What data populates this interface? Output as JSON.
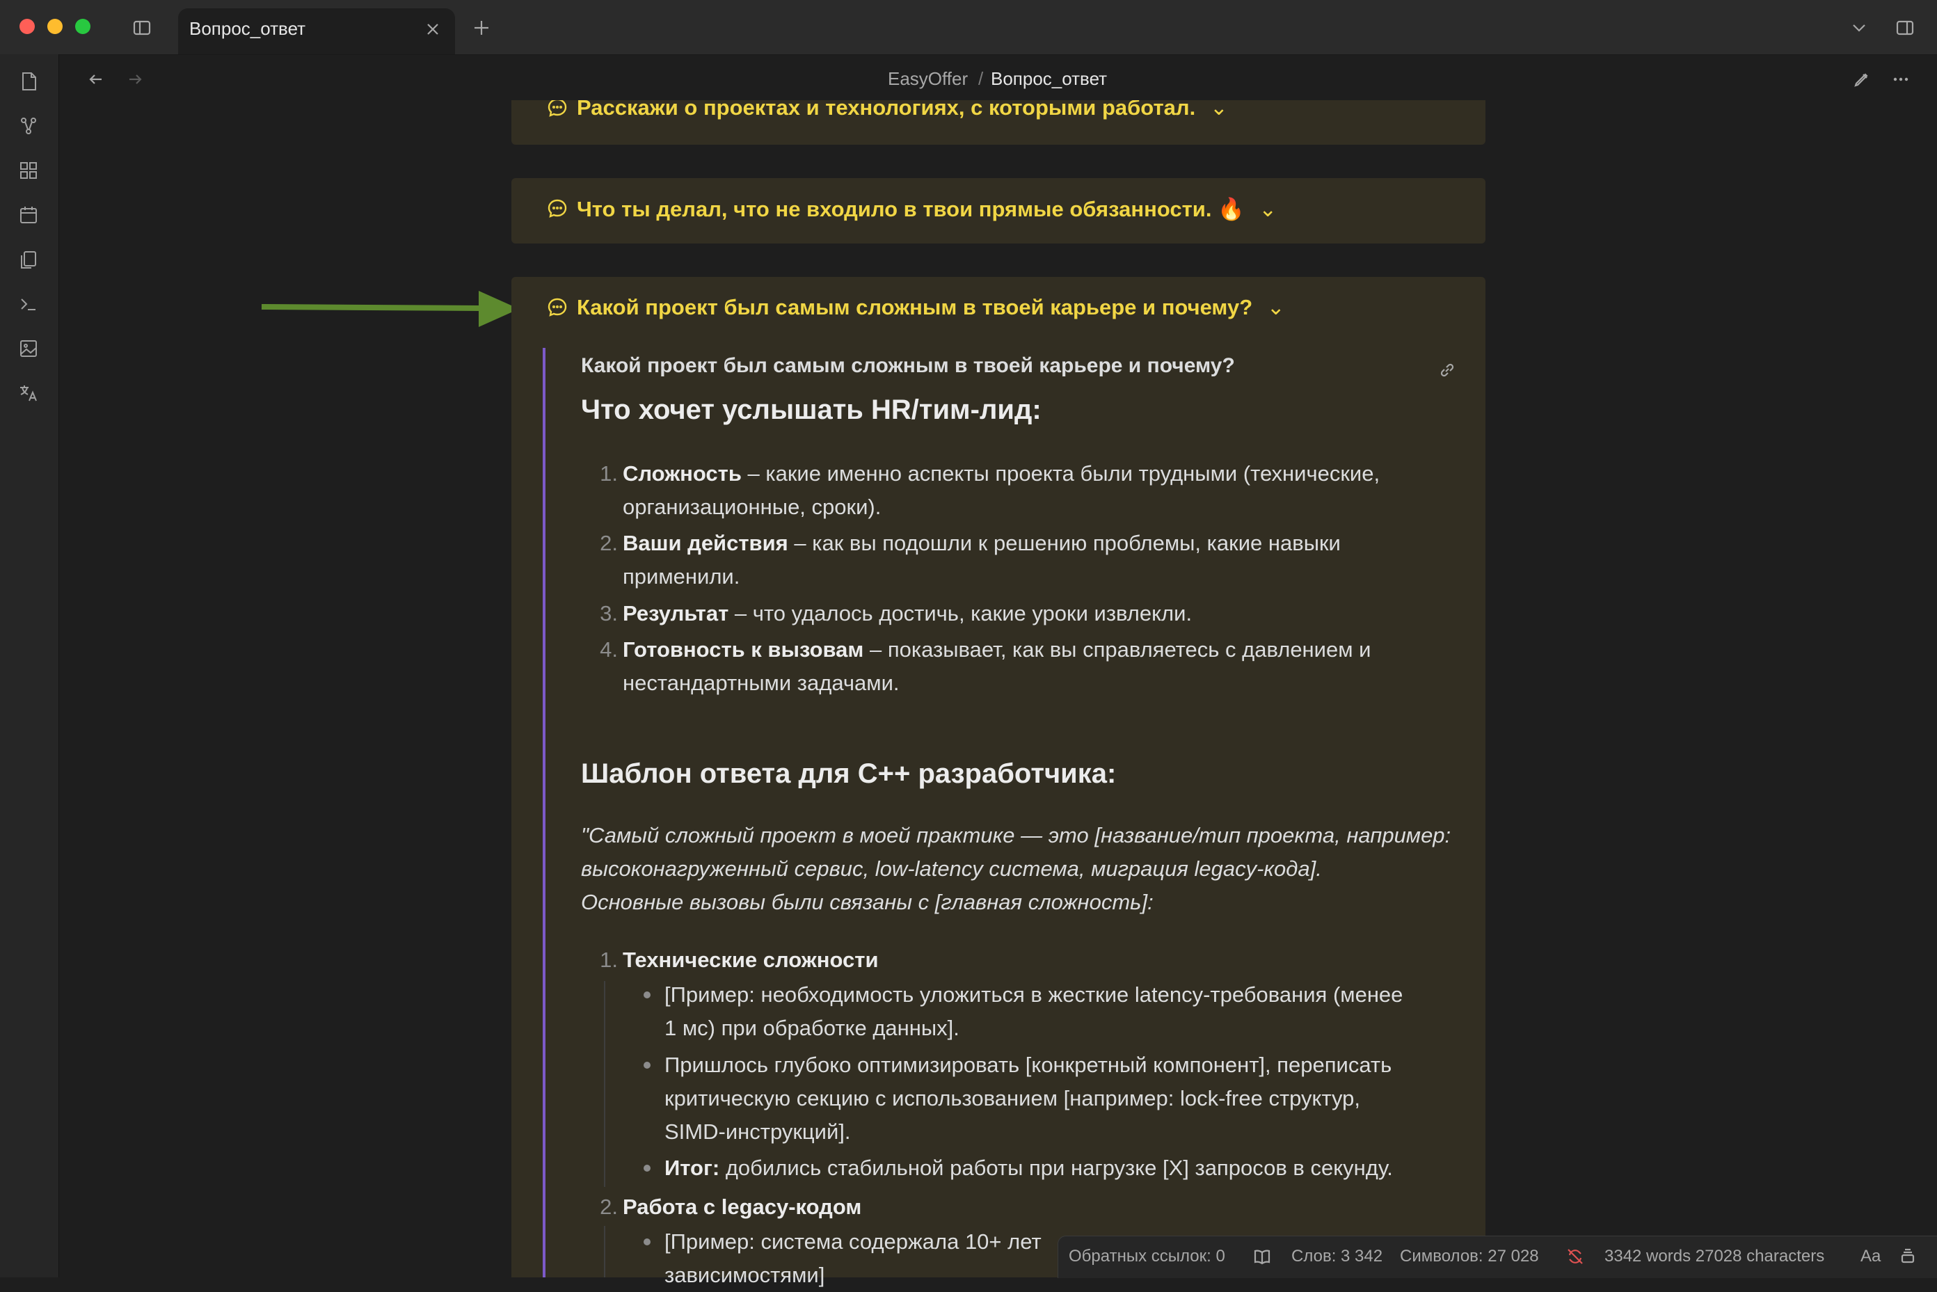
{
  "tab": {
    "title": "Вопрос_ответ"
  },
  "breadcrumb": {
    "vault": "EasyOffer",
    "separator": "/",
    "note": "Вопрос_ответ"
  },
  "callouts": [
    "Расскажи о проектах и технологиях, с которыми работал.",
    "Что ты делал, что не входило в твои прямые обязанности. 🔥",
    "Какой проект был самым сложным в твоей карьере и почему?"
  ],
  "question": "Какой проект был самым сложным в твоей карьере и почему?",
  "section1": {
    "heading": "Что хочет услышать HR/тим-лид:",
    "items": [
      {
        "num": "1.",
        "bold": "Сложность",
        "rest": " – какие именно аспекты проекта были трудными (технические,",
        "cont": "организационные, сроки)."
      },
      {
        "num": "2.",
        "bold": "Ваши действия",
        "rest": " – как вы подошли к решению проблемы, какие навыки",
        "cont": "применили."
      },
      {
        "num": "3.",
        "bold": "Результат",
        "rest": " – что удалось достичь, какие уроки извлекли.",
        "cont": ""
      },
      {
        "num": "4.",
        "bold": "Готовность к вызовам",
        "rest": " – показывает, как вы справляетесь с давлением и",
        "cont": "нестандартными задачами."
      }
    ]
  },
  "section2": {
    "heading": "Шаблон ответа для C++ разработчика:",
    "quote": [
      "\"Самый сложный проект в моей практике — это [название/тип проекта, например:",
      "высоконагруженный сервис, low-latency система, миграция legacy-кода].",
      "Основные вызовы были связаны с [главная сложность]:"
    ],
    "item1": "Технические сложности",
    "bullets": [
      [
        "[Пример: необходимость уложиться в жесткие latency-требования (менее",
        "1 мс) при обработке данных]."
      ],
      [
        "Пришлось глубоко оптимизировать [конкретный компонент], переписать",
        "критическую секцию с использованием [например: lock-free структур,",
        "SIMD-инструкций]."
      ]
    ],
    "result_bold": "Итог:",
    "result_rest": " добились стабильной работы при нагрузке [X] запросов в секунду.",
    "item2": "Работа с legacy-кодом",
    "item2_bullet": "[Пример: система содержала 10+ лет",
    "item2_bullet_cont": "зависимостями]"
  },
  "status": {
    "backlinks": "Обратных ссылок: 0",
    "words": "Слов: 3 342",
    "chars": "Символов: 27 028",
    "wordcount": "3342 words 27028 characters",
    "font": "Aa"
  },
  "colors": {
    "accent": "#f1d645",
    "arrow": "#5d8a2e",
    "quote_line": "#7c5ac8",
    "callout_bg": "#322e22"
  }
}
